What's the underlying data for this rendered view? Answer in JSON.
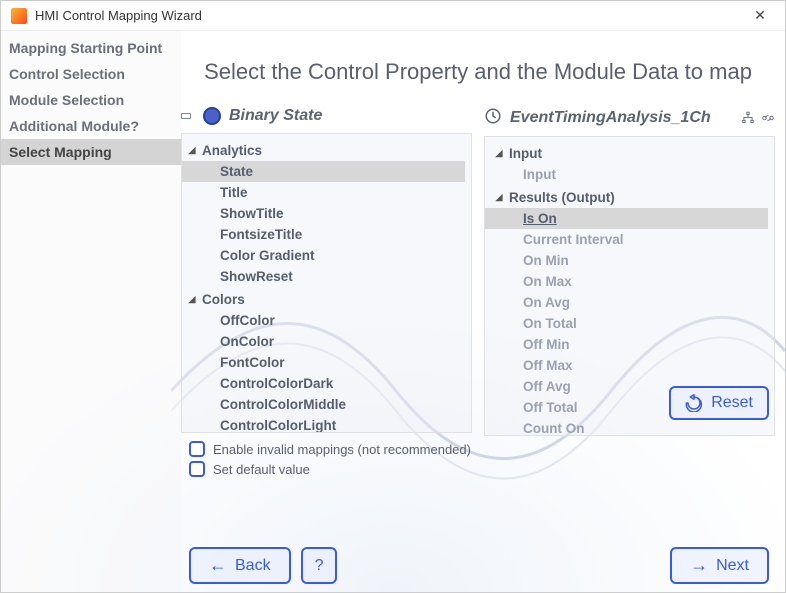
{
  "window": {
    "title": "HMI Control Mapping Wizard"
  },
  "sidebar": {
    "items": [
      {
        "label": "Mapping Starting Point"
      },
      {
        "label": "Control Selection"
      },
      {
        "label": "Module Selection"
      },
      {
        "label": "Additional Module?"
      },
      {
        "label": "Select Mapping"
      }
    ],
    "active_index": 4
  },
  "main": {
    "heading": "Select the Control Property and the Module Data to map"
  },
  "left_panel": {
    "title": "Binary State",
    "groups": [
      {
        "name": "Analytics",
        "items": [
          {
            "label": "State",
            "selected": true
          },
          {
            "label": "Title"
          },
          {
            "label": "ShowTitle"
          },
          {
            "label": "FontsizeTitle"
          },
          {
            "label": "Color Gradient"
          },
          {
            "label": "ShowReset"
          }
        ]
      },
      {
        "name": "Colors",
        "items": [
          {
            "label": "OffColor"
          },
          {
            "label": "OnColor"
          },
          {
            "label": "FontColor"
          },
          {
            "label": "ControlColorDark"
          },
          {
            "label": "ControlColorMiddle"
          },
          {
            "label": "ControlColorLight"
          }
        ]
      }
    ]
  },
  "right_panel": {
    "title": "EventTimingAnalysis_1Ch",
    "groups": [
      {
        "name": "Input",
        "items": [
          {
            "label": "Input",
            "muted": true
          }
        ]
      },
      {
        "name": "Results (Output)",
        "items": [
          {
            "label": "Is On",
            "selected": true,
            "underlined": true
          },
          {
            "label": "Current Interval",
            "muted": true
          },
          {
            "label": "On Min",
            "muted": true
          },
          {
            "label": "On Max",
            "muted": true
          },
          {
            "label": "On Avg",
            "muted": true
          },
          {
            "label": "On Total",
            "muted": true
          },
          {
            "label": "Off Min",
            "muted": true
          },
          {
            "label": "Off Max",
            "muted": true
          },
          {
            "label": "Off Avg",
            "muted": true
          },
          {
            "label": "Off Total",
            "muted": true
          },
          {
            "label": "Count On",
            "muted": true
          }
        ]
      }
    ]
  },
  "options": {
    "invalid_mappings_label": "Enable invalid mappings (not recommended)",
    "set_default_value_label": "Set default value"
  },
  "buttons": {
    "reset": "Reset",
    "back": "Back",
    "help": "?",
    "next": "Next"
  }
}
